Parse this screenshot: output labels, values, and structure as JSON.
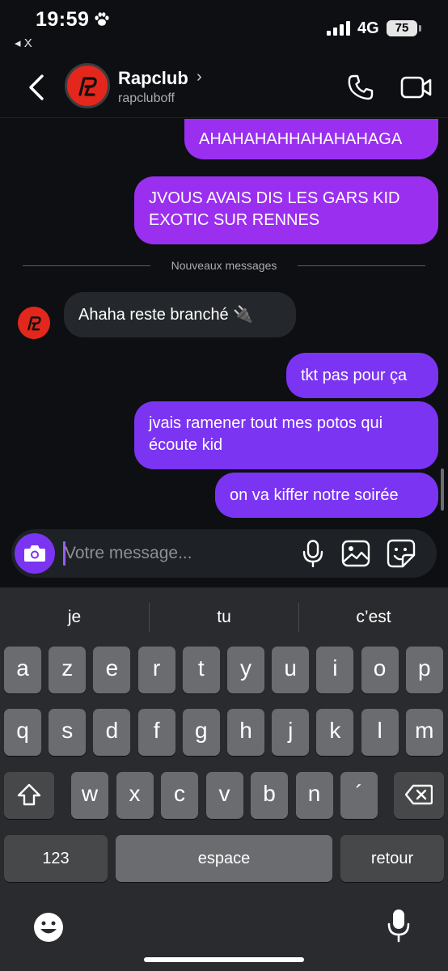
{
  "status_bar": {
    "time": "19:59",
    "back_app": "◂ X",
    "network": "4G",
    "battery": "75",
    "battery_level": 0.75
  },
  "header": {
    "name": "Rapclub",
    "handle": "rapcluboff"
  },
  "messages": [
    {
      "from": "me",
      "text": "AHAHAHAHHAHAHAHAGA"
    },
    {
      "from": "me",
      "text": "JVOUS AVAIS DIS LES GARS KID EXOTIC SUR RENNES"
    },
    {
      "from": "them",
      "text": "Ahaha reste branché 🔌"
    },
    {
      "from": "me",
      "text": "tkt pas pour ça"
    },
    {
      "from": "me",
      "text": "jvais ramener tout mes potos qui écoute kid"
    },
    {
      "from": "me",
      "text": "on va kiffer notre soirée"
    }
  ],
  "divider": {
    "label": "Nouveaux messages"
  },
  "composer": {
    "placeholder": "Votre message...",
    "value": ""
  },
  "keyboard": {
    "suggestions": [
      "je",
      "tu",
      "c’est"
    ],
    "row1": [
      "a",
      "z",
      "e",
      "r",
      "t",
      "y",
      "u",
      "i",
      "o",
      "p"
    ],
    "row2": [
      "q",
      "s",
      "d",
      "f",
      "g",
      "h",
      "j",
      "k",
      "l",
      "m"
    ],
    "row3": [
      "w",
      "x",
      "c",
      "v",
      "b",
      "n",
      "´"
    ],
    "numbers_label": "123",
    "space_label": "espace",
    "return_label": "retour"
  },
  "colors": {
    "bubble_out_pink": "#9a2ff0",
    "bubble_out_violet": "#7a34f2",
    "bubble_in": "#24272b",
    "brand": "#e3271c"
  },
  "icons": [
    "paw-icon",
    "signal-icon",
    "back-chevron-icon",
    "rapclub-logo",
    "phone-icon",
    "video-icon",
    "camera-icon",
    "microphone-icon",
    "image-icon",
    "sticker-icon",
    "shift-icon",
    "backspace-icon",
    "emoji-icon",
    "dictation-icon"
  ]
}
